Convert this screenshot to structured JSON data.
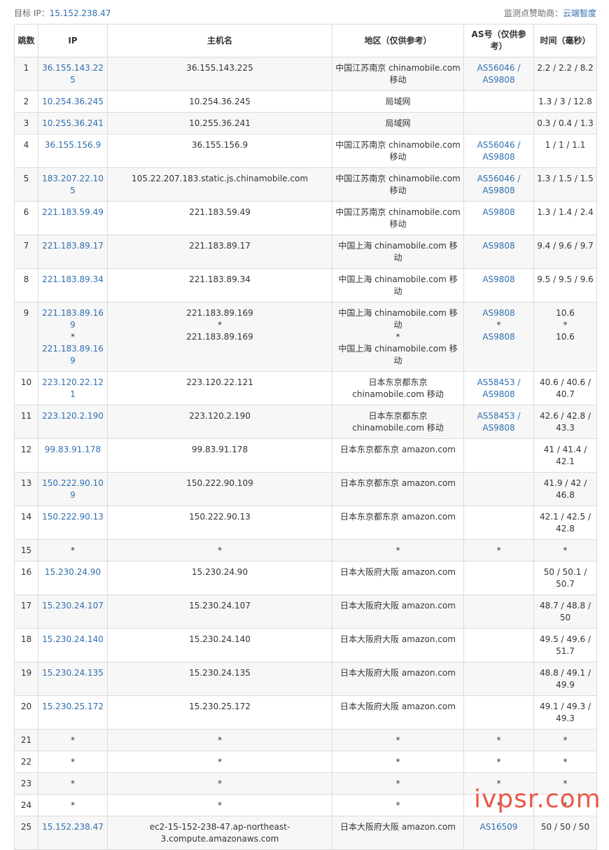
{
  "header": {
    "target_label": "目标 IP：",
    "target_ip": "15.152.238.47",
    "sponsor_label": "监测点赞助商：",
    "sponsor_name": "云端智度"
  },
  "table": {
    "columns": [
      "跳数",
      "IP",
      "主机名",
      "地区（仅供参考）",
      "AS号（仅供参考）",
      "时间（毫秒）"
    ],
    "rows": [
      {
        "hop": "1",
        "ip": [
          "36.155.143.225"
        ],
        "host": [
          "36.155.143.225"
        ],
        "region": [
          "中国江苏南京 chinamobile.com 移动"
        ],
        "as": [
          "AS56046 /",
          "AS9808"
        ],
        "time": [
          "2.2 / 2.2 / 8.2"
        ]
      },
      {
        "hop": "2",
        "ip": [
          "10.254.36.245"
        ],
        "host": [
          "10.254.36.245"
        ],
        "region": [
          "局域网"
        ],
        "as": [],
        "time": [
          "1.3 / 3 / 12.8"
        ]
      },
      {
        "hop": "3",
        "ip": [
          "10.255.36.241"
        ],
        "host": [
          "10.255.36.241"
        ],
        "region": [
          "局域网"
        ],
        "as": [],
        "time": [
          "0.3 / 0.4 / 1.3"
        ]
      },
      {
        "hop": "4",
        "ip": [
          "36.155.156.9"
        ],
        "host": [
          "36.155.156.9"
        ],
        "region": [
          "中国江苏南京 chinamobile.com 移动"
        ],
        "as": [
          "AS56046 /",
          "AS9808"
        ],
        "time": [
          "1 / 1 / 1.1"
        ]
      },
      {
        "hop": "5",
        "ip": [
          "183.207.22.105"
        ],
        "host": [
          "105.22.207.183.static.js.chinamobile.com"
        ],
        "region": [
          "中国江苏南京 chinamobile.com 移动"
        ],
        "as": [
          "AS56046 /",
          "AS9808"
        ],
        "time": [
          "1.3 / 1.5 / 1.5"
        ]
      },
      {
        "hop": "6",
        "ip": [
          "221.183.59.49"
        ],
        "host": [
          "221.183.59.49"
        ],
        "region": [
          "中国江苏南京 chinamobile.com 移动"
        ],
        "as": [
          "AS9808"
        ],
        "time": [
          "1.3 / 1.4 / 2.4"
        ]
      },
      {
        "hop": "7",
        "ip": [
          "221.183.89.17"
        ],
        "host": [
          "221.183.89.17"
        ],
        "region": [
          "中国上海 chinamobile.com 移动"
        ],
        "as": [
          "AS9808"
        ],
        "time": [
          "9.4 / 9.6 / 9.7"
        ]
      },
      {
        "hop": "8",
        "ip": [
          "221.183.89.34"
        ],
        "host": [
          "221.183.89.34"
        ],
        "region": [
          "中国上海 chinamobile.com 移动"
        ],
        "as": [
          "AS9808"
        ],
        "time": [
          "9.5 / 9.5 / 9.6"
        ]
      },
      {
        "hop": "9",
        "ip": [
          "221.183.89.169",
          "*",
          "221.183.89.169"
        ],
        "host": [
          "221.183.89.169",
          "*",
          "221.183.89.169"
        ],
        "region": [
          "中国上海 chinamobile.com 移动",
          "*",
          "中国上海 chinamobile.com 移动"
        ],
        "as": [
          "AS9808",
          "*",
          "AS9808"
        ],
        "time": [
          "10.6",
          "*",
          "10.6"
        ]
      },
      {
        "hop": "10",
        "ip": [
          "223.120.22.121"
        ],
        "host": [
          "223.120.22.121"
        ],
        "region": [
          "日本东京都东京 chinamobile.com 移动"
        ],
        "as": [
          "AS58453 /",
          "AS9808"
        ],
        "time": [
          "40.6 / 40.6 / 40.7"
        ]
      },
      {
        "hop": "11",
        "ip": [
          "223.120.2.190"
        ],
        "host": [
          "223.120.2.190"
        ],
        "region": [
          "日本东京都东京 chinamobile.com 移动"
        ],
        "as": [
          "AS58453 /",
          "AS9808"
        ],
        "time": [
          "42.6 / 42.8 / 43.3"
        ]
      },
      {
        "hop": "12",
        "ip": [
          "99.83.91.178"
        ],
        "host": [
          "99.83.91.178"
        ],
        "region": [
          "日本东京都东京 amazon.com"
        ],
        "as": [],
        "time": [
          "41 / 41.4 / 42.1"
        ]
      },
      {
        "hop": "13",
        "ip": [
          "150.222.90.109"
        ],
        "host": [
          "150.222.90.109"
        ],
        "region": [
          "日本东京都东京 amazon.com"
        ],
        "as": [],
        "time": [
          "41.9 / 42 / 46.8"
        ]
      },
      {
        "hop": "14",
        "ip": [
          "150.222.90.13"
        ],
        "host": [
          "150.222.90.13"
        ],
        "region": [
          "日本东京都东京 amazon.com"
        ],
        "as": [],
        "time": [
          "42.1 / 42.5 / 42.8"
        ]
      },
      {
        "hop": "15",
        "star": true,
        "ip": [
          "*"
        ],
        "host": [
          "*"
        ],
        "region": [
          "*"
        ],
        "as": [
          "*"
        ],
        "time": [
          "*"
        ]
      },
      {
        "hop": "16",
        "ip": [
          "15.230.24.90"
        ],
        "host": [
          "15.230.24.90"
        ],
        "region": [
          "日本大阪府大阪 amazon.com"
        ],
        "as": [],
        "time": [
          "50 / 50.1 / 50.7"
        ]
      },
      {
        "hop": "17",
        "ip": [
          "15.230.24.107"
        ],
        "host": [
          "15.230.24.107"
        ],
        "region": [
          "日本大阪府大阪 amazon.com"
        ],
        "as": [],
        "time": [
          "48.7 / 48.8 / 50"
        ]
      },
      {
        "hop": "18",
        "ip": [
          "15.230.24.140"
        ],
        "host": [
          "15.230.24.140"
        ],
        "region": [
          "日本大阪府大阪 amazon.com"
        ],
        "as": [],
        "time": [
          "49.5 / 49.6 / 51.7"
        ]
      },
      {
        "hop": "19",
        "ip": [
          "15.230.24.135"
        ],
        "host": [
          "15.230.24.135"
        ],
        "region": [
          "日本大阪府大阪 amazon.com"
        ],
        "as": [],
        "time": [
          "48.8 / 49.1 / 49.9"
        ]
      },
      {
        "hop": "20",
        "ip": [
          "15.230.25.172"
        ],
        "host": [
          "15.230.25.172"
        ],
        "region": [
          "日本大阪府大阪 amazon.com"
        ],
        "as": [],
        "time": [
          "49.1 / 49.3 / 49.3"
        ]
      },
      {
        "hop": "21",
        "star": true,
        "ip": [
          "*"
        ],
        "host": [
          "*"
        ],
        "region": [
          "*"
        ],
        "as": [
          "*"
        ],
        "time": [
          "*"
        ]
      },
      {
        "hop": "22",
        "star": true,
        "ip": [
          "*"
        ],
        "host": [
          "*"
        ],
        "region": [
          "*"
        ],
        "as": [
          "*"
        ],
        "time": [
          "*"
        ]
      },
      {
        "hop": "23",
        "star": true,
        "ip": [
          "*"
        ],
        "host": [
          "*"
        ],
        "region": [
          "*"
        ],
        "as": [
          "*"
        ],
        "time": [
          "*"
        ]
      },
      {
        "hop": "24",
        "star": true,
        "ip": [
          "*"
        ],
        "host": [
          "*"
        ],
        "region": [
          "*"
        ],
        "as": [
          "*"
        ],
        "time": [
          "*"
        ]
      },
      {
        "hop": "25",
        "ip": [
          "15.152.238.47"
        ],
        "host": [
          "ec2-15-152-238-47.ap-northeast-3.compute.amazonaws.com"
        ],
        "region": [
          "日本大阪府大阪 amazon.com"
        ],
        "as": [
          "AS16509"
        ],
        "time": [
          "50 / 50 / 50"
        ]
      }
    ]
  },
  "watermark": "ivpsr.com"
}
